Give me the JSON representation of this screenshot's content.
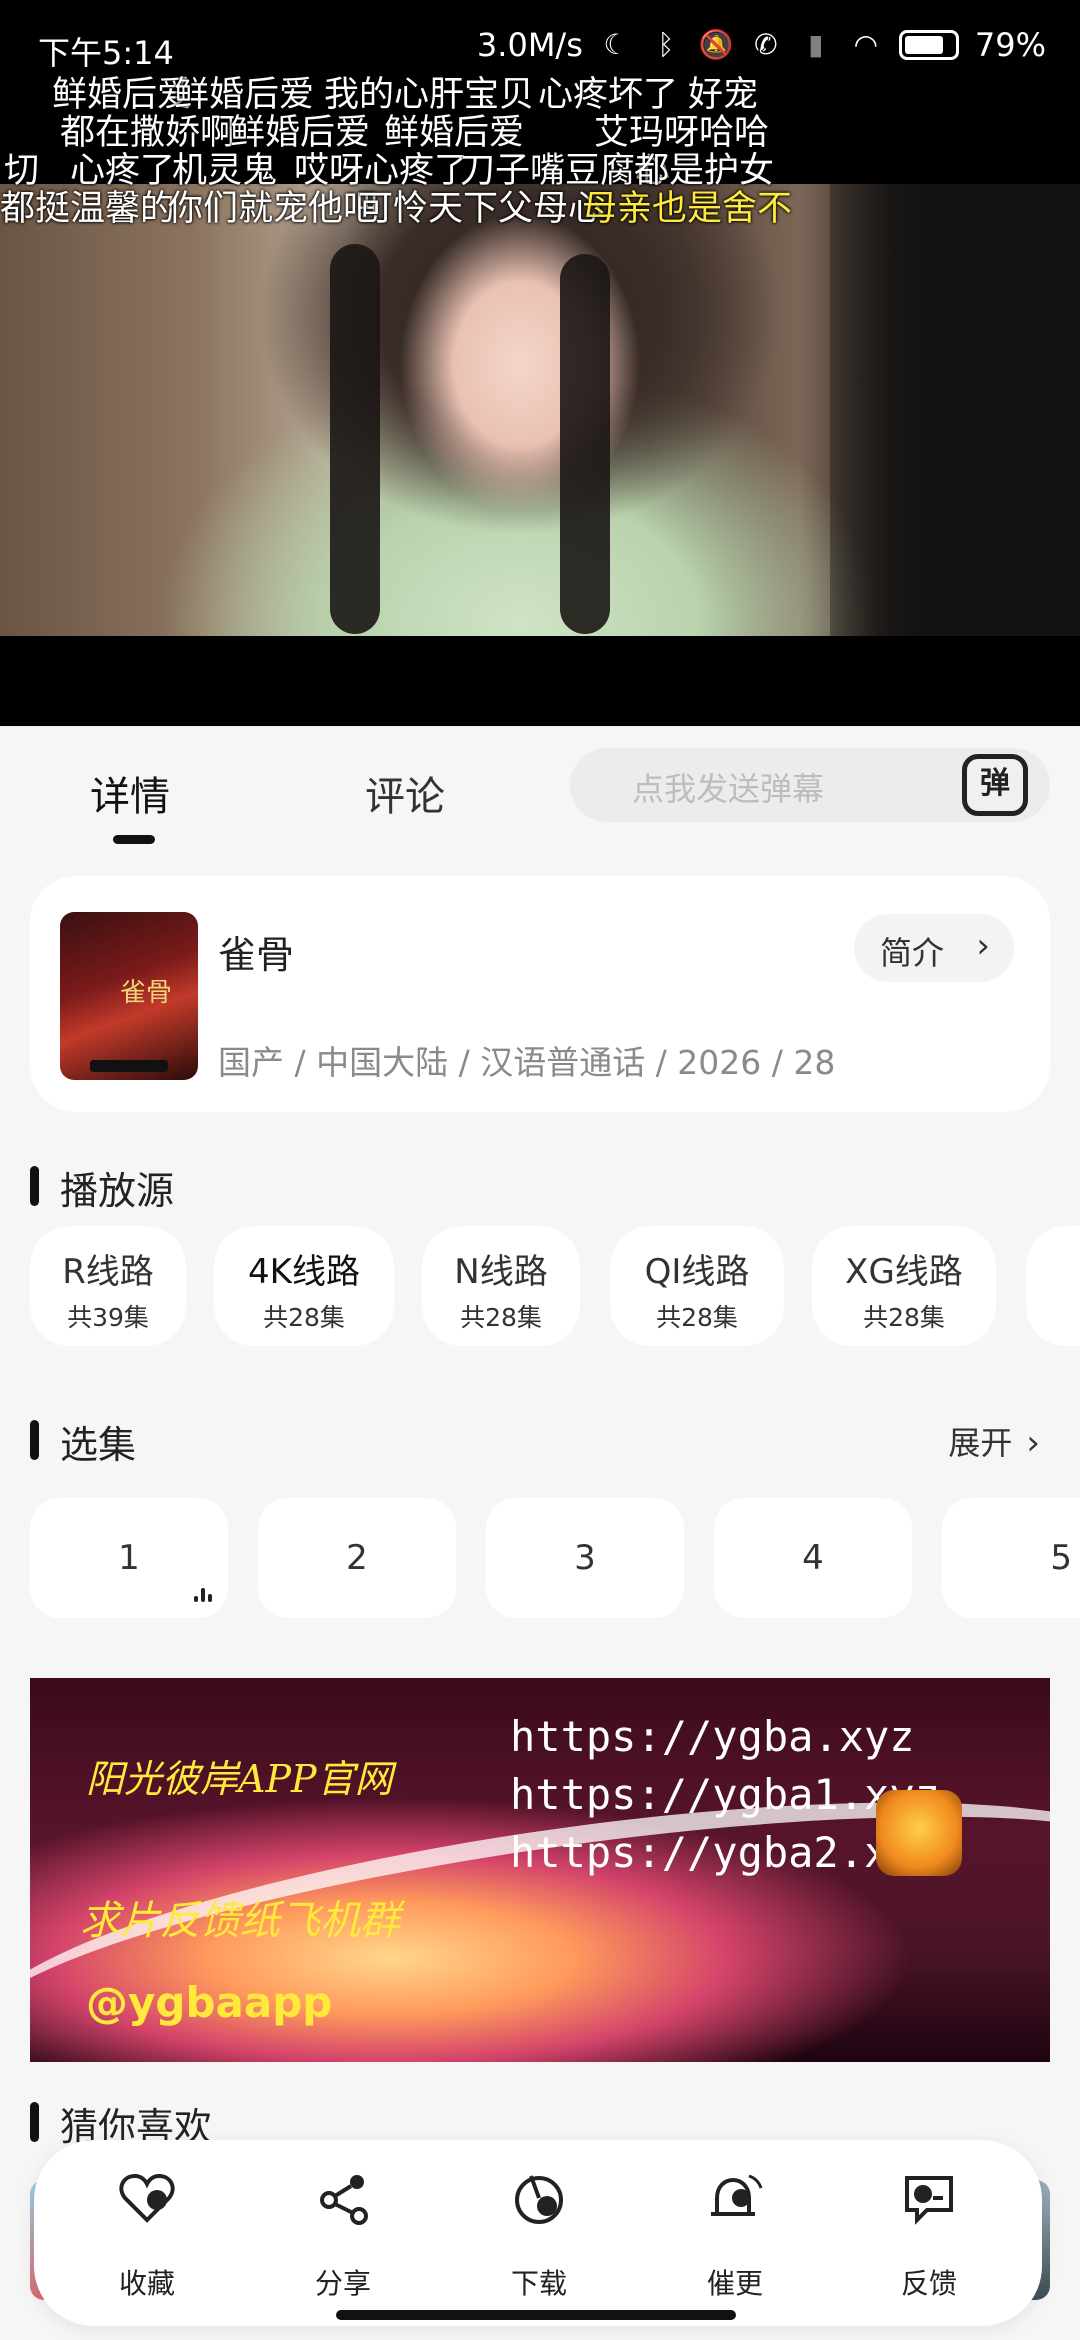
{
  "status": {
    "time": "下午5:14",
    "net_speed": "3.0M/s",
    "battery": "79%",
    "battery_level": 0.79
  },
  "danmaku": [
    "鲜婚后爱",
    "鲜婚后爱",
    "我的心肝宝贝",
    "心疼坏了",
    "好宠",
    "都在撒娇啊",
    "鲜婚后爱",
    "鲜婚后爱",
    "艾玛呀哈哈",
    "切",
    "心疼了",
    "机灵鬼",
    "哎呀心疼了",
    "刀子嘴豆腐心",
    "都是护女",
    "都挺温馨的",
    "你们就宠他吧",
    "可怜天下父母心",
    "母亲也是舍不"
  ],
  "tabs": {
    "details": "详情",
    "comments": "评论",
    "danmu_placeholder": "点我发送弹幕",
    "danmu_button": "弹"
  },
  "show": {
    "title": "雀骨",
    "intro_label": "简介",
    "meta": "国产 / 中国大陆 / 汉语普通话 / 2026 / 28",
    "poster_text": "雀骨"
  },
  "sources": {
    "title": "播放源",
    "items": [
      {
        "name": "R线路",
        "count": "共39集"
      },
      {
        "name": "4K线路",
        "count": "共28集"
      },
      {
        "name": "N线路",
        "count": "共28集"
      },
      {
        "name": "QI线路",
        "count": "共28集"
      },
      {
        "name": "XG线路",
        "count": "共28集"
      }
    ]
  },
  "episodes": {
    "title": "选集",
    "expand_label": "展开",
    "items": [
      "1",
      "2",
      "3",
      "4",
      "5"
    ]
  },
  "banner": {
    "cn_line1": "阳光彼岸APP官网",
    "cn_line2": "求片反馈纸飞机群",
    "handle": "@ygbaapp",
    "urls": [
      "https://ygba.xyz",
      "https://ygba1.xyz",
      "https://ygba2.xyz"
    ]
  },
  "recommend": {
    "title": "猜你喜欢"
  },
  "actions": {
    "favorite": "收藏",
    "share": "分享",
    "download": "下载",
    "remind": "催更",
    "feedback": "反馈"
  }
}
